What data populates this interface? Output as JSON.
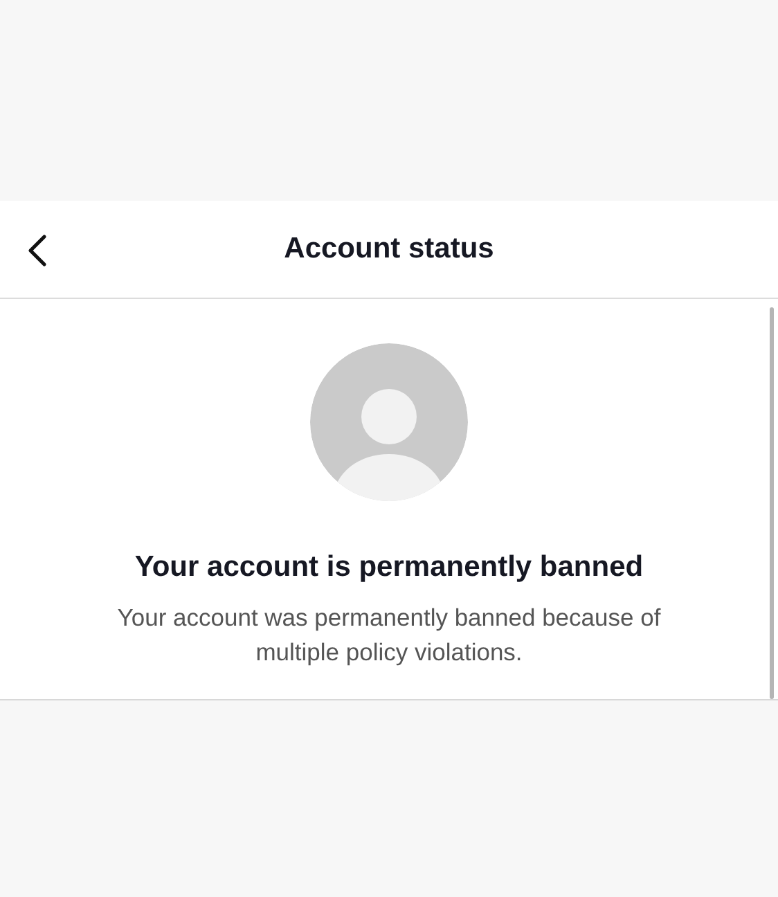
{
  "header": {
    "title": "Account status"
  },
  "status": {
    "heading": "Your account is permanently banned",
    "message": "Your account was permanently banned because of multiple policy violations."
  }
}
